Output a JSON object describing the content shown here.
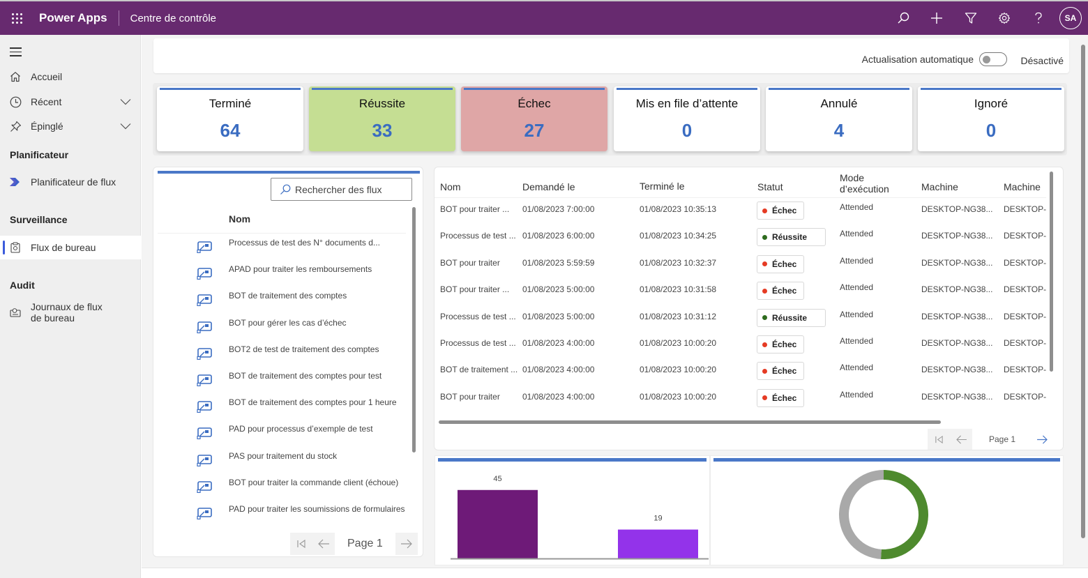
{
  "header": {
    "app_name": "Power Apps",
    "page_name": "Centre de contrôle",
    "icons": [
      "waffle-icon",
      "search-icon",
      "add-icon",
      "filter-icon",
      "settings-icon",
      "help-icon"
    ],
    "user_initials": "SA"
  },
  "sidebar": {
    "nav": [
      {
        "label": "Accueil",
        "icon": "home-icon"
      },
      {
        "label": "Récent",
        "icon": "clock-icon",
        "expandable": true
      },
      {
        "label": "Épinglé",
        "icon": "pin-icon",
        "expandable": true
      }
    ],
    "sections": [
      {
        "title": "Planificateur",
        "items": [
          {
            "label": "Planificateur de flux",
            "icon": "scheduler-icon"
          }
        ]
      },
      {
        "title": "Surveillance",
        "items": [
          {
            "label": "Flux de bureau",
            "icon": "desktop-flow-monitor-icon",
            "active": true
          }
        ]
      },
      {
        "title": "Audit",
        "items": [
          {
            "label": "Journaux de flux de bureau",
            "line1": "Journaux de flux",
            "line2": "de bureau",
            "icon": "logs-icon"
          }
        ]
      }
    ]
  },
  "refresh": {
    "label": "Actualisation automatique",
    "toggle_state": "Désactivé",
    "enabled": false
  },
  "stats": [
    {
      "title": "Terminé",
      "value": "64",
      "bg": "#ffffff"
    },
    {
      "title": "Réussite",
      "value": "33",
      "bg": "#c5de93"
    },
    {
      "title": "Échec",
      "value": "27",
      "bg": "#dfa6a6"
    },
    {
      "title": "Mis en file d’attente",
      "value": "0",
      "bg": "#ffffff"
    },
    {
      "title": "Annulé",
      "value": "4",
      "bg": "#ffffff"
    },
    {
      "title": "Ignoré",
      "value": "0",
      "bg": "#ffffff"
    }
  ],
  "flows": {
    "search_placeholder": "Rechercher des flux",
    "column": "Nom",
    "items": [
      "Processus de test des N° documents d...",
      "APAD pour traiter les remboursements",
      "BOT de traitement des comptes",
      "BOT pour gérer les cas d’échec",
      "BOT2 de test de traitement des comptes",
      "BOT de traitement des comptes pour test",
      "BOT de traitement des comptes pour 1 heure",
      "PAD pour processus d’exemple de test",
      "PAS pour traitement du stock",
      "BOT pour traiter la commande client (échoue)",
      "PAD pour traiter les soumissions de formulaires"
    ],
    "page_label": "Page 1"
  },
  "runs": {
    "columns": [
      "Nom",
      "Demandé le",
      "Terminé le",
      "Statut",
      "Mode d’exécution",
      "Machine",
      "Machine"
    ],
    "column_mode_line1": "Mode",
    "column_mode_line2": "d’exécution",
    "rows": [
      {
        "name": "BOT pour traiter ...",
        "requested": "01/08/2023 7:00:00",
        "completed": "01/08/2023 10:35:13",
        "status": "Échec",
        "mode": "Attended",
        "machine": "DESKTOP-NG38...",
        "machine2": "DESKTOP-"
      },
      {
        "name": "Processus de test ...",
        "requested": "01/08/2023 6:00:00",
        "completed": "01/08/2023 10:34:25",
        "status": "Réussite",
        "mode": "Attended",
        "machine": "DESKTOP-NG38...",
        "machine2": "DESKTOP-"
      },
      {
        "name": "BOT pour traiter",
        "requested": "01/08/2023 5:59:59",
        "completed": "01/08/2023 10:32:37",
        "status": "Échec",
        "mode": "Attended",
        "machine": "DESKTOP-NG38...",
        "machine2": "DESKTOP-"
      },
      {
        "name": "BOT pour traiter ...",
        "requested": "01/08/2023 5:00:00",
        "completed": "01/08/2023 10:31:58",
        "status": "Échec",
        "mode": "Attended",
        "machine": "DESKTOP-NG38...",
        "machine2": "DESKTOP-"
      },
      {
        "name": "Processus de test ...",
        "requested": "01/08/2023 5:00:00",
        "completed": "01/08/2023 10:31:12",
        "status": "Réussite",
        "mode": "Attended",
        "machine": "DESKTOP-NG38...",
        "machine2": "DESKTOP-"
      },
      {
        "name": "Processus de test ...",
        "requested": "01/08/2023 4:00:00",
        "completed": "01/08/2023 10:00:20",
        "status": "Échec",
        "mode": "Attended",
        "machine": "DESKTOP-NG38...",
        "machine2": "DESKTOP-"
      },
      {
        "name": "BOT de traitement ...",
        "requested": "01/08/2023 4:00:00",
        "completed": "01/08/2023 10:00:20",
        "status": "Échec",
        "mode": "Attended",
        "machine": "DESKTOP-NG38...",
        "machine2": "DESKTOP-"
      },
      {
        "name": "BOT pour traiter",
        "requested": "01/08/2023 4:00:00",
        "completed": "01/08/2023 10:00:20",
        "status": "Échec",
        "mode": "Attended",
        "machine": "DESKTOP-NG38...",
        "machine2": "DESKTOP-"
      }
    ],
    "status_colors": {
      "Échec": "#e53b24",
      "Réussite": "#2e6b1e"
    },
    "page_label": "Page 1"
  },
  "colors": {
    "header_bg": "#672a6f",
    "accent_blue": "#4a78c8",
    "stat_value": "#3a6cc1"
  },
  "chart_data": [
    {
      "type": "bar",
      "title": "",
      "categories": [
        "",
        ""
      ],
      "values": [
        45,
        19
      ],
      "colors": [
        "#6e1a78",
        "#9333ea"
      ],
      "data_labels": [
        "45",
        "19"
      ],
      "ylim": [
        0,
        50
      ],
      "grid": false,
      "legend": "none"
    },
    {
      "type": "pie",
      "donut": true,
      "title": "",
      "labels": [
        "",
        ""
      ],
      "values": [
        51,
        49
      ],
      "colors": [
        "#4e8a2e",
        "#a9a9a9"
      ],
      "legend": "none"
    }
  ]
}
